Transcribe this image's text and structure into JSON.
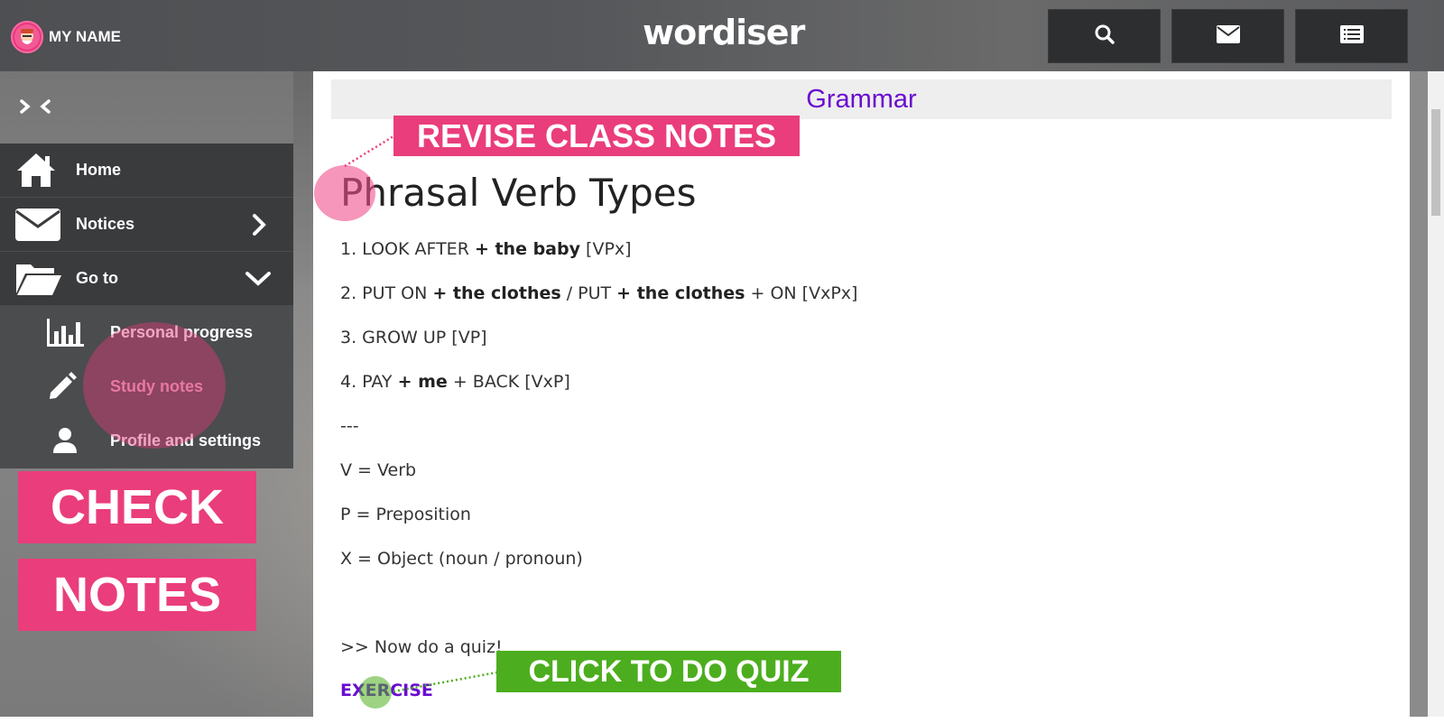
{
  "user": {
    "name": "MY NAME"
  },
  "logo": "wordiser",
  "topbar": {
    "buttons": [
      {
        "icon": "search-icon"
      },
      {
        "icon": "mail-icon"
      },
      {
        "icon": "menu-list-icon"
      }
    ]
  },
  "sidebar": {
    "collapse_icon": "collapse-arrows-icon",
    "items": [
      {
        "label": "Home",
        "icon": "home-icon"
      },
      {
        "label": "Notices",
        "icon": "mail-icon",
        "arrow": "chevron-right-icon"
      },
      {
        "label": "Go to",
        "icon": "folder-open-icon",
        "arrow": "chevron-down-icon"
      }
    ],
    "subitems": [
      {
        "label": "Personal progress",
        "icon": "bar-chart-icon"
      },
      {
        "label": "Study notes",
        "icon": "pencil-icon",
        "active": true
      },
      {
        "label": "Profile and settings",
        "icon": "user-icon"
      }
    ]
  },
  "callouts": {
    "check": "CHECK",
    "notes": "NOTES",
    "revise": "REVISE CLASS NOTES",
    "quiz": "CLICK TO DO QUIZ"
  },
  "content": {
    "section": "Grammar",
    "title": "Phrasal Verb Types",
    "lines": [
      {
        "parts": [
          {
            "t": "1. LOOK AFTER "
          },
          {
            "t": "+ the baby",
            "b": true
          },
          {
            "t": " [VPx]"
          }
        ]
      },
      {
        "parts": [
          {
            "t": "2. PUT ON "
          },
          {
            "t": "+ the clothes",
            "b": true
          },
          {
            "t": " / PUT "
          },
          {
            "t": "+ the clothes",
            "b": true
          },
          {
            "t": " + ON [VxPx]"
          }
        ]
      },
      {
        "parts": [
          {
            "t": "3. GROW UP [VP]"
          }
        ]
      },
      {
        "parts": [
          {
            "t": "4. PAY "
          },
          {
            "t": "+ me",
            "b": true
          },
          {
            "t": " + BACK [VxP]"
          }
        ]
      },
      {
        "parts": [
          {
            "t": "---"
          }
        ]
      },
      {
        "parts": [
          {
            "t": "V = Verb"
          }
        ]
      },
      {
        "parts": [
          {
            "t": "P = Preposition"
          }
        ]
      },
      {
        "parts": [
          {
            "t": "X = Object (noun / pronoun)"
          }
        ]
      },
      {
        "parts": [
          {
            "t": ">> Now do a quiz!"
          }
        ]
      }
    ],
    "exercise": "EXERCISE"
  },
  "colors": {
    "accent_pink": "#ea3d7b",
    "accent_green": "#4cae1e",
    "link_purple": "#6a0bd0"
  }
}
